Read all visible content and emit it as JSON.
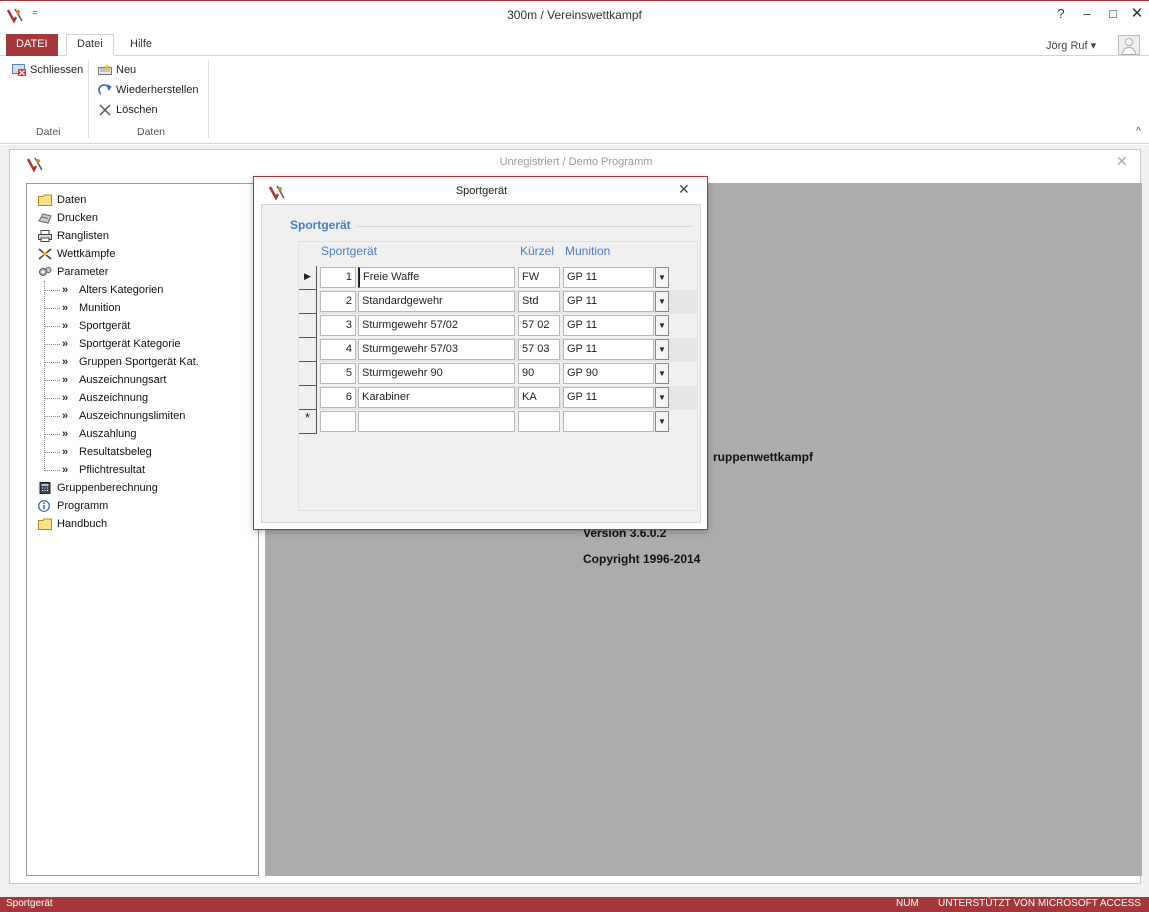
{
  "window": {
    "title": "300m / Vereinswettkampf",
    "help": "?",
    "minimize": "–",
    "maximize": "□",
    "close": "✕",
    "qat": "="
  },
  "ribbon": {
    "tabs": [
      {
        "label": "DATEI"
      },
      {
        "label": "Datei"
      },
      {
        "label": "Hilfe"
      }
    ],
    "user": "Jörg Ruf",
    "user_caret": "▾",
    "buttons": {
      "schliessen": "Schliessen",
      "neu": "Neu",
      "wiederherstellen": "Wiederherstellen",
      "loeschen": "Löschen"
    },
    "groups": {
      "datei": "Datei",
      "daten": "Daten"
    },
    "collapse": "^"
  },
  "inner_window": {
    "title": "Unregistriert  /  Demo Programm",
    "close": "✕"
  },
  "nav": {
    "top_items": [
      {
        "label": "Daten",
        "icon": "folder-icon"
      },
      {
        "label": "Drucken",
        "icon": "print-icon"
      },
      {
        "label": "Ranglisten",
        "icon": "printer-icon"
      },
      {
        "label": "Wettkämpfe",
        "icon": "crossed-rifles-icon"
      },
      {
        "label": "Parameter",
        "icon": "gears-icon"
      }
    ],
    "parameter_items": [
      {
        "label": "Alters Kategorien"
      },
      {
        "label": "Munition"
      },
      {
        "label": "Sportgerät"
      },
      {
        "label": "Sportgerät Kategorie"
      },
      {
        "label": "Gruppen Sportgerät Kat."
      },
      {
        "label": "Auszeichnungsart"
      },
      {
        "label": "Auszeichnung"
      },
      {
        "label": "Auszeichnungslimiten"
      },
      {
        "label": "Auszahlung"
      },
      {
        "label": "Resultatsbeleg"
      },
      {
        "label": "Pflichtresultat"
      }
    ],
    "bottom_items": [
      {
        "label": "Gruppenberechnung",
        "icon": "calculator-icon"
      },
      {
        "label": "Programm",
        "icon": "info-icon"
      },
      {
        "label": "Handbuch",
        "icon": "folder-icon"
      }
    ]
  },
  "content": {
    "line1": "ruppenwettkampf",
    "line2": "Version 3.6.0.2",
    "line3": "Copyright  1996-2014"
  },
  "dialog": {
    "title": "Sportgerät",
    "close": "✕",
    "section": "Sportgerät",
    "columns": {
      "sportgeraet": "Sportgerät",
      "kuerzel": "Kürzel",
      "munition": "Munition"
    },
    "rows": [
      {
        "nr": "1",
        "name": "Freie Waffe",
        "kurz": "FW",
        "mun": "GP 11",
        "current": true
      },
      {
        "nr": "2",
        "name": "Standardgewehr",
        "kurz": "Std",
        "mun": "GP 11"
      },
      {
        "nr": "3",
        "name": "Sturmgewehr 57/02",
        "kurz": "57 02",
        "mun": "GP 11"
      },
      {
        "nr": "4",
        "name": "Sturmgewehr 57/03",
        "kurz": "57 03",
        "mun": "GP 11"
      },
      {
        "nr": "5",
        "name": "Sturmgewehr 90",
        "kurz": "90",
        "mun": "GP 90"
      },
      {
        "nr": "6",
        "name": "Karabiner",
        "kurz": "KA",
        "mun": "GP 11"
      }
    ],
    "new_row_marker": "*",
    "current_row_marker": "▶"
  },
  "statusbar": {
    "left": "Sportgerät",
    "num": "NUM",
    "right": "UNTERSTÜTZT VON MICROSOFT ACCESS"
  },
  "colors": {
    "accent": "#a4373a",
    "link_blue": "#4a7dc8",
    "content_grey": "#acacac"
  }
}
